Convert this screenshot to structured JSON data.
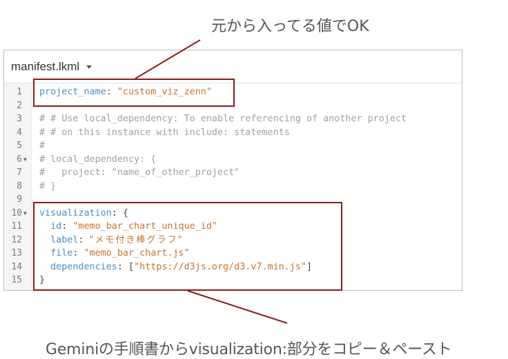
{
  "annotations": {
    "top": "元から入ってる値でOK",
    "bottom": "Geminiの手順書からvisualization:部分をコピー＆ペースト"
  },
  "editor": {
    "file_name": "manifest.lkml",
    "dropdown_icon": "caret-down-icon",
    "lines": [
      {
        "n": "1",
        "fold": false,
        "segments": [
          {
            "t": "project_name",
            "c": "k"
          },
          {
            "t": ": ",
            "c": "p"
          },
          {
            "t": "\"custom_viz_zenn\"",
            "c": "s"
          }
        ]
      },
      {
        "n": "2",
        "fold": false,
        "segments": []
      },
      {
        "n": "3",
        "fold": false,
        "segments": [
          {
            "t": "# # Use local_dependency: To enable referencing of another project",
            "c": "c"
          }
        ]
      },
      {
        "n": "4",
        "fold": false,
        "segments": [
          {
            "t": "# # on this instance with include: statements",
            "c": "c"
          }
        ]
      },
      {
        "n": "5",
        "fold": false,
        "segments": [
          {
            "t": "#",
            "c": "c"
          }
        ]
      },
      {
        "n": "6",
        "fold": true,
        "segments": [
          {
            "t": "# local_dependency: {",
            "c": "c"
          }
        ]
      },
      {
        "n": "7",
        "fold": false,
        "segments": [
          {
            "t": "#   project: \"name_of_other_project\"",
            "c": "c"
          }
        ]
      },
      {
        "n": "8",
        "fold": false,
        "segments": [
          {
            "t": "# }",
            "c": "c"
          }
        ]
      },
      {
        "n": "9",
        "fold": false,
        "segments": []
      },
      {
        "n": "10",
        "fold": true,
        "segments": [
          {
            "t": "visualization",
            "c": "k"
          },
          {
            "t": ": {",
            "c": "p"
          }
        ]
      },
      {
        "n": "11",
        "fold": false,
        "segments": [
          {
            "t": "  ",
            "c": "p"
          },
          {
            "t": "id",
            "c": "k"
          },
          {
            "t": ": ",
            "c": "p"
          },
          {
            "t": "\"memo_bar_chart_unique_id\"",
            "c": "s"
          }
        ]
      },
      {
        "n": "12",
        "fold": false,
        "segments": [
          {
            "t": "  ",
            "c": "p"
          },
          {
            "t": "label",
            "c": "k"
          },
          {
            "t": ": ",
            "c": "p"
          },
          {
            "t": "\"メモ付き棒グラフ\"",
            "c": "s jp"
          }
        ]
      },
      {
        "n": "13",
        "fold": false,
        "segments": [
          {
            "t": "  ",
            "c": "p"
          },
          {
            "t": "file",
            "c": "k"
          },
          {
            "t": ": ",
            "c": "p"
          },
          {
            "t": "\"memo_bar_chart.js\"",
            "c": "s"
          }
        ]
      },
      {
        "n": "14",
        "fold": false,
        "segments": [
          {
            "t": "  ",
            "c": "p"
          },
          {
            "t": "dependencies",
            "c": "k"
          },
          {
            "t": ": [",
            "c": "p"
          },
          {
            "t": "\"https://d3js.org/d3.v7.min.js\"",
            "c": "s"
          },
          {
            "t": "]",
            "c": "p"
          }
        ]
      },
      {
        "n": "15",
        "fold": false,
        "segments": [
          {
            "t": "}",
            "c": "p"
          }
        ]
      }
    ]
  },
  "colors": {
    "highlight_box": "#8b1a1a",
    "keyword": "#4a8fc4",
    "string": "#c9722e",
    "comment": "#a0a0a0"
  }
}
